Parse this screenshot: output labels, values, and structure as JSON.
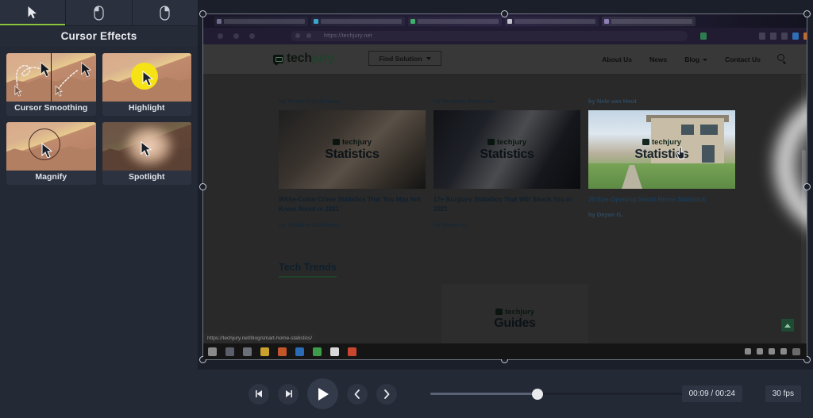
{
  "panel": {
    "title": "Cursor Effects",
    "tabs": [
      {
        "name": "cursor-tab",
        "icon": "cursor-arrow-icon",
        "active": true
      },
      {
        "name": "left-click-tab",
        "icon": "mouse-left-click-icon",
        "active": false
      },
      {
        "name": "right-click-tab",
        "icon": "mouse-right-click-icon",
        "active": false
      }
    ],
    "effects": [
      {
        "label": "Cursor Smoothing",
        "icon": "cursor-smoothing-thumb"
      },
      {
        "label": "Highlight",
        "icon": "highlight-thumb"
      },
      {
        "label": "Magnify",
        "icon": "magnify-thumb"
      },
      {
        "label": "Spotlight",
        "icon": "spotlight-thumb"
      }
    ]
  },
  "browser": {
    "url": "https://techjury.net",
    "status_tooltip": "https://techjury.net/blog/smart-home-statistics/"
  },
  "site": {
    "logo_a": "tech",
    "logo_b": "jury",
    "find_button": "Find Solution",
    "nav": [
      {
        "label": "About Us",
        "caret": false
      },
      {
        "label": "News",
        "caret": false
      },
      {
        "label": "Blog",
        "caret": true
      },
      {
        "label": "Contact Us",
        "caret": false
      }
    ],
    "search_icon": "search-icon",
    "cards": [
      {
        "byline_top": "by Teodora Dobrilova",
        "overlay_logo": "techjury",
        "overlay_label": "Statistics",
        "title": "White-Collar Crime Statistics That You May Not Know About in 2021",
        "byline_bottom": "by Teodora Dobrilova"
      },
      {
        "byline_top": "by Teodora Dobrilova",
        "overlay_logo": "techjury",
        "overlay_label": "Statistics",
        "title": "17+ Burglary Statistics That Will Shock You in 2021",
        "byline_bottom": "by Deyan G."
      },
      {
        "byline_top": "by Nele van Hout",
        "overlay_logo": "techjury",
        "overlay_label": "Statistics",
        "title": "20 Eye-Opening Smart Home Statistics",
        "byline_bottom": "by Deyan G."
      }
    ],
    "section_heading": "Tech Trends",
    "guides_card": {
      "overlay_logo": "techjury",
      "overlay_label": "Guides"
    },
    "scroll_top_icon": "scroll-to-top-icon"
  },
  "controls": {
    "buttons": [
      {
        "name": "previous-frame-button",
        "icon": "step-backward-icon"
      },
      {
        "name": "next-frame-button",
        "icon": "step-forward-icon"
      },
      {
        "name": "play-button",
        "icon": "play-icon"
      },
      {
        "name": "previous-marker-button",
        "icon": "chevron-left-icon"
      },
      {
        "name": "next-marker-button",
        "icon": "chevron-right-icon"
      }
    ],
    "timeline_position_percent": 39,
    "time_display": "00:09 / 00:24",
    "fps_display": "30 fps"
  },
  "colors": {
    "accent_green": "#8ac53e",
    "panel_bg": "#242936",
    "app_bg": "#1b1f2a",
    "highlight_yellow": "#f5e316",
    "site_green": "#3f7e52"
  }
}
